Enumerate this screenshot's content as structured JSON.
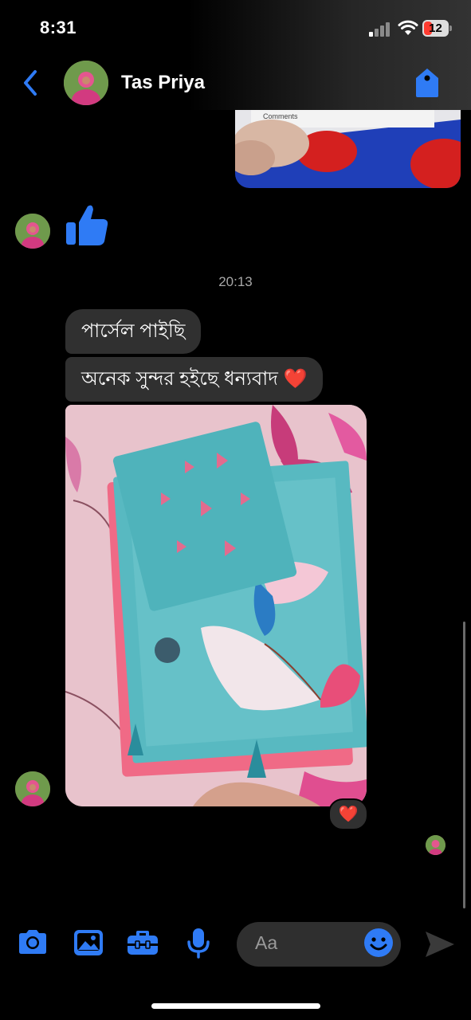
{
  "status_bar": {
    "time": "8:31",
    "battery": "12"
  },
  "header": {
    "contact_name": "Tas Priya"
  },
  "messages": {
    "timestamp": "20:13",
    "bubble_1": "পার্সেল পাইছি",
    "bubble_2": "অনেক সুন্দর হইছে ধন্যবাদ",
    "bubble_2_emoji": "❤️",
    "reaction": "❤️"
  },
  "composer": {
    "placeholder": "Aa"
  },
  "colors": {
    "accent": "#2f7bf5",
    "bubble": "#303030",
    "background": "#000000",
    "heart": "#ff2d3a"
  },
  "icons": [
    "back-chevron-icon",
    "tag-icon",
    "thumbs-up-icon",
    "camera-icon",
    "gallery-icon",
    "toolbox-icon",
    "microphone-icon",
    "emoji-icon",
    "send-icon"
  ]
}
